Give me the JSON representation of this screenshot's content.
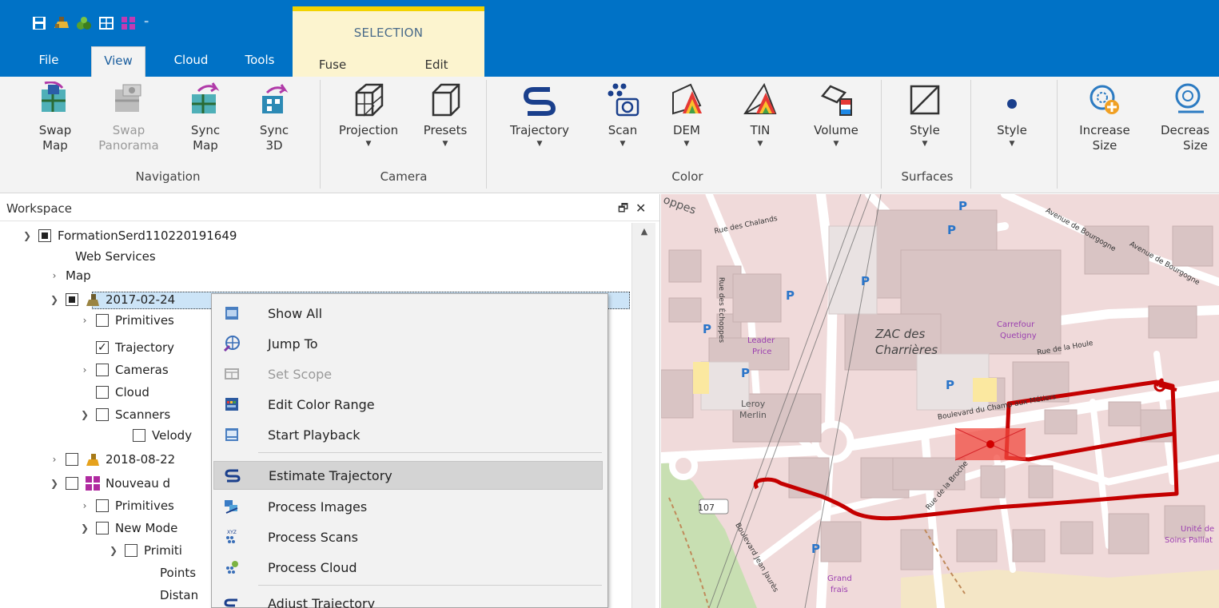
{
  "quick_access": {
    "icons": [
      "save-icon",
      "open-project-icon",
      "trajectory-project-icon",
      "map-icon",
      "model-icon"
    ],
    "overflow": "⁼"
  },
  "tabs": [
    "File",
    "View",
    "Cloud",
    "Tools"
  ],
  "active_tab": "View",
  "selection_group": {
    "label": "SELECTION",
    "tabs": [
      "Fuse",
      "Edit"
    ]
  },
  "ribbon": {
    "navigation": {
      "label": "Navigation",
      "buttons": [
        {
          "line1": "Swap",
          "line2": "Map",
          "disabled": false
        },
        {
          "line1": "Swap",
          "line2": "Panorama",
          "disabled": true
        },
        {
          "line1": "Sync",
          "line2": "Map",
          "disabled": false
        },
        {
          "line1": "Sync",
          "line2": "3D",
          "disabled": false
        }
      ]
    },
    "camera": {
      "label": "Camera",
      "buttons": [
        {
          "line1": "Projection"
        },
        {
          "line1": "Presets"
        }
      ]
    },
    "color": {
      "label": "Color",
      "buttons": [
        {
          "line1": "Trajectory"
        },
        {
          "line1": "Scan"
        },
        {
          "line1": "DEM"
        },
        {
          "line1": "TIN"
        },
        {
          "line1": "Volume"
        }
      ]
    },
    "surfaces": {
      "label": "Surfaces",
      "buttons": [
        {
          "line1": "Style"
        }
      ]
    },
    "points": {
      "buttons": [
        {
          "line1": "Style"
        },
        {
          "line1": "Increase",
          "line2": "Size"
        },
        {
          "line1": "Decreas",
          "line2": "Size"
        }
      ]
    }
  },
  "workspace": {
    "title": "Workspace",
    "pin": "🗗",
    "close": "✕",
    "tree": [
      {
        "label": "FormationSerd110220191649"
      },
      {
        "label": "Web Services"
      },
      {
        "label": "Map"
      },
      {
        "label": "2017-02-24"
      },
      {
        "label": "Primitives"
      },
      {
        "label": "Trajectory"
      },
      {
        "label": "Cameras"
      },
      {
        "label": "Cloud"
      },
      {
        "label": "Scanners"
      },
      {
        "label": "Velody"
      },
      {
        "label": "2018-08-22"
      },
      {
        "label": "Nouveau d"
      },
      {
        "label": "Primitives"
      },
      {
        "label": "New Mode"
      },
      {
        "label": "Primiti"
      },
      {
        "label": "Points"
      },
      {
        "label": "Distan"
      }
    ]
  },
  "context_menu": {
    "items": [
      {
        "label": "Show All",
        "disabled": false
      },
      {
        "label": "Jump To",
        "disabled": false
      },
      {
        "label": "Set Scope",
        "disabled": true
      },
      {
        "label": "Edit Color Range",
        "disabled": false
      },
      {
        "label": "Start Playback",
        "disabled": false
      },
      {
        "label": "Estimate Trajectory",
        "disabled": false,
        "hover": true
      },
      {
        "label": "Process Images",
        "disabled": false
      },
      {
        "label": "Process Scans",
        "disabled": false
      },
      {
        "label": "Process Cloud",
        "disabled": false
      },
      {
        "label": "Adjust Trajectory",
        "disabled": false
      }
    ]
  },
  "map": {
    "labels": {
      "zac": "ZAC des",
      "charrieres": "Charrières",
      "leroy": "Leroy",
      "merlin": "Merlin",
      "leader": "Leader",
      "price": "Price",
      "carrefour": "Carrefour",
      "quetigny": "Quetigny",
      "unite": "Unité de",
      "soins": "Soins Palliat",
      "grand": "Grand",
      "frais": "frais",
      "road_chalands": "Rue des Chalands",
      "road_echoppes": "Rue des Échoppes",
      "road_bourgogne": "Avenue de Bourgogne",
      "road_houle": "Rue de la Houle",
      "road_boulevard": "Boulevard du Champ aux Métiers",
      "road_broche": "Rue de la Broche",
      "road_jaures": "Boulevard Jean Jaurès",
      "road_num": "107",
      "oppes": "oppes"
    },
    "trajectory_color": "#c40000",
    "selection_color": "#f24a3f"
  },
  "colors": {
    "title_bar": "#0072c6",
    "ribbon": "#f3f3f3",
    "selection_band": "#f2d300"
  }
}
